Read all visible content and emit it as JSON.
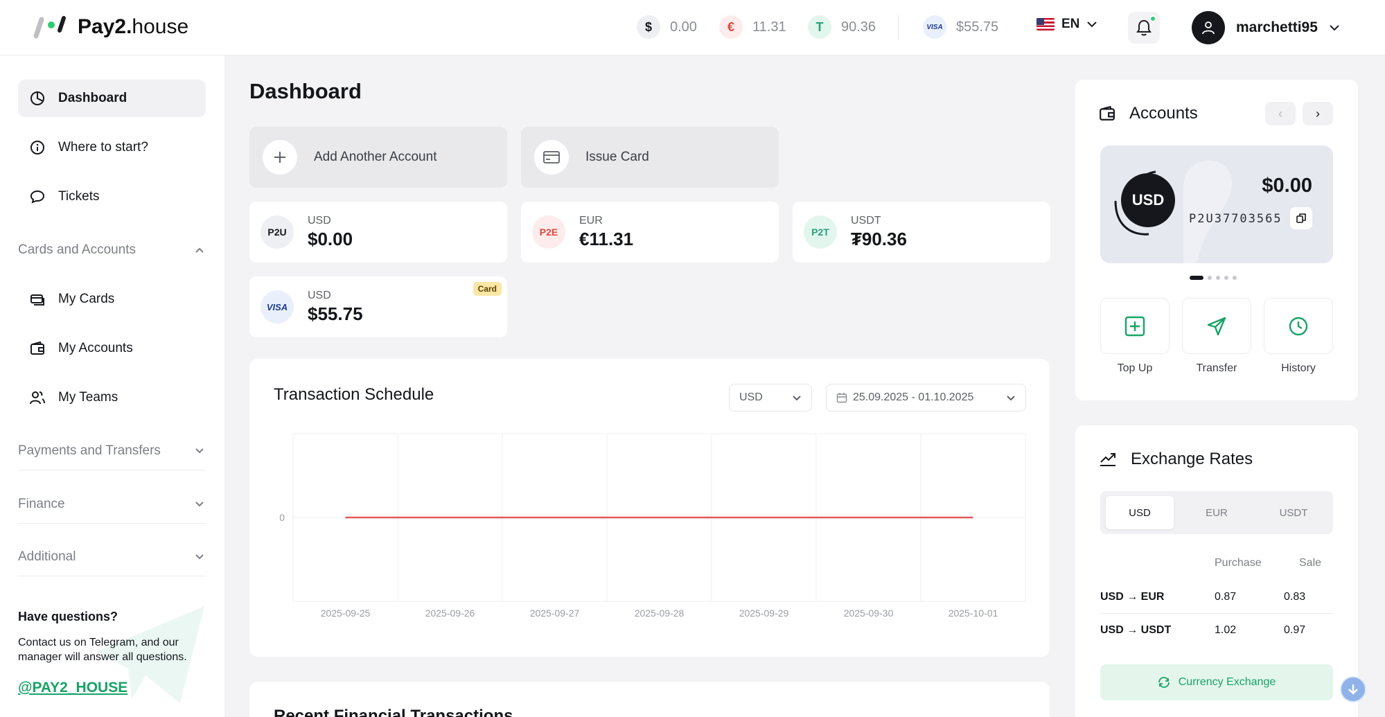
{
  "header": {
    "logo_brand": "Pay2.",
    "logo_suffix": "house",
    "balances": [
      {
        "symbol": "$",
        "value": "0.00"
      },
      {
        "symbol": "€",
        "value": "11.31"
      },
      {
        "symbol": "T",
        "value": "90.36"
      },
      {
        "symbol": "VISA",
        "value": "$55.75"
      }
    ],
    "language": "EN",
    "username": "marchetti95"
  },
  "sidebar": {
    "items": [
      {
        "label": "Dashboard"
      },
      {
        "label": "Where to start?"
      },
      {
        "label": "Tickets"
      }
    ],
    "groups": {
      "cards_accounts": "Cards and Accounts",
      "payments": "Payments and Transfers",
      "finance": "Finance",
      "additional": "Additional"
    },
    "sub_items": [
      {
        "label": "My Cards"
      },
      {
        "label": "My Accounts"
      },
      {
        "label": "My Teams"
      }
    ],
    "help": {
      "title": "Have questions?",
      "text": "Contact us on Telegram, and our manager will answer all questions.",
      "link": "@PAY2_HOUSE"
    }
  },
  "main": {
    "title": "Dashboard",
    "actions": {
      "add_account": "Add Another Account",
      "issue_card": "Issue Card"
    },
    "accounts": [
      {
        "badge": "P2U",
        "currency": "USD",
        "amount": "$0.00"
      },
      {
        "badge": "P2E",
        "currency": "EUR",
        "amount": "€11.31"
      },
      {
        "badge": "P2T",
        "currency": "USDT",
        "amount": "₮90.36"
      },
      {
        "badge": "VISA",
        "currency": "USD",
        "amount": "$55.75",
        "tag": "Card"
      }
    ],
    "chart_panel": {
      "title": "Transaction Schedule",
      "currency_select": "USD",
      "date_range": "25.09.2025 - 01.10.2025"
    },
    "recent_title": "Recent Financial Transactions"
  },
  "chart_data": {
    "type": "line",
    "title": "Transaction Schedule",
    "xlabel": "",
    "ylabel": "",
    "x": [
      "2025-09-25",
      "2025-09-26",
      "2025-09-27",
      "2025-09-28",
      "2025-09-29",
      "2025-09-30",
      "2025-10-01"
    ],
    "series": [
      {
        "values": [
          0,
          0,
          0,
          0,
          0,
          0,
          0
        ],
        "color": "#e05a5a"
      }
    ],
    "yticks": [
      "0"
    ],
    "grid": true
  },
  "right": {
    "accounts": {
      "title": "Accounts",
      "badge": "USD",
      "amount": "$0.00",
      "number": "P2U37703565",
      "actions": [
        {
          "label": "Top Up"
        },
        {
          "label": "Transfer"
        },
        {
          "label": "History"
        }
      ]
    },
    "rates": {
      "title": "Exchange Rates",
      "tabs": [
        "USD",
        "EUR",
        "USDT"
      ],
      "col_purchase": "Purchase",
      "col_sale": "Sale",
      "rows": [
        {
          "pair": "USD → EUR",
          "purchase": "0.87",
          "sale": "0.83"
        },
        {
          "pair": "USD → USDT",
          "purchase": "1.02",
          "sale": "0.97"
        }
      ],
      "exchange_button": "Currency Exchange"
    }
  },
  "colors": {
    "accent_green": "#17a366",
    "chart_line": "#e05a5a",
    "dark": "#15171c"
  }
}
